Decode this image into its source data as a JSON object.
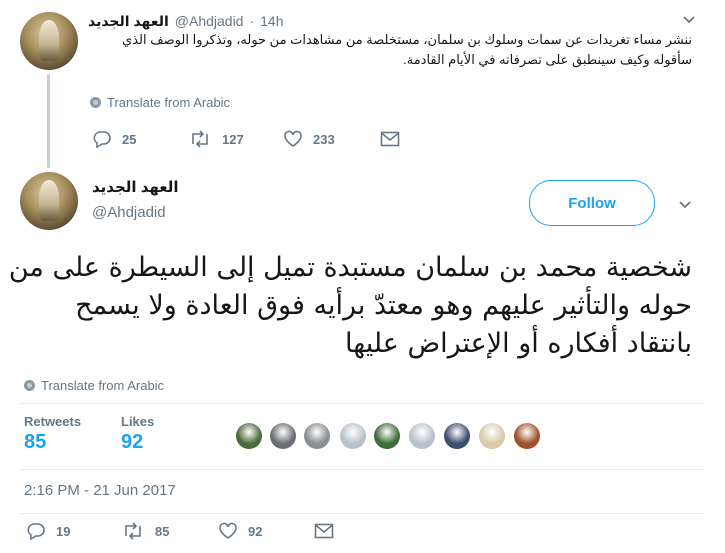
{
  "reply_tweet": {
    "display_name": "العهد الجديد",
    "handle": "@Ahdjadid",
    "separator": "·",
    "time": "14h",
    "text_line1": "ننشر مساء تغريدات عن سمات وسلوك بن سلمان، مستخلصة من مشاهدات من حوله، وتذكروا الوصف الذي",
    "text_line2": "سأقوله وكيف سينطبق على تصرفاته في الأيام القادمة.",
    "translate": "Translate from Arabic",
    "replies": "25",
    "retweets": "127",
    "likes": "233"
  },
  "main_tweet": {
    "display_name": "العهد الجديد",
    "handle": "@Ahdjadid",
    "follow_label": "Follow",
    "text_line1": "شخصية محمد بن سلمان مستبدة تميل إلى السيطرة على من",
    "text_line2": "حوله والتأثير عليهم وهو معتدّ برأيه فوق العادة ولا يسمح",
    "text_line3": "بانتقاد أفكاره أو الإعتراض عليها",
    "translate": "Translate from Arabic",
    "retweets_label": "Retweets",
    "retweets_value": "85",
    "likes_label": "Likes",
    "likes_value": "92",
    "timestamp": "2:16 PM - 21 Jun 2017",
    "action_replies": "19",
    "action_retweets": "85",
    "action_likes": "92"
  },
  "likers": [
    {
      "name": "liker-avatar-1",
      "color": "#4a6b3a"
    },
    {
      "name": "liker-avatar-2",
      "color": "#6b6f74"
    },
    {
      "name": "liker-avatar-3",
      "color": "#8a8d91"
    },
    {
      "name": "liker-avatar-4",
      "color": "#b8c2cc"
    },
    {
      "name": "liker-avatar-5",
      "color": "#3f6e3a"
    },
    {
      "name": "liker-avatar-6",
      "color": "#b8c2cc"
    },
    {
      "name": "liker-avatar-7",
      "color": "#3a4f6e"
    },
    {
      "name": "liker-avatar-8",
      "color": "#d8c9a8"
    },
    {
      "name": "liker-avatar-9",
      "color": "#a0522d"
    }
  ],
  "colors": {
    "accent": "#1da1f2",
    "muted": "#657786",
    "border": "#e6ecf0"
  }
}
